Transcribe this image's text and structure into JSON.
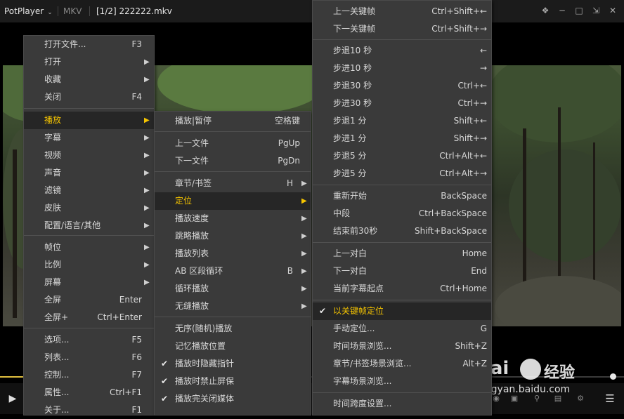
{
  "titlebar": {
    "app_name": "PotPlayer",
    "format": "MKV",
    "title": "[1/2] 222222.mkv"
  },
  "playback": {
    "seek_progress": 0.045
  },
  "main_menu": {
    "items": [
      {
        "label": "打开文件...",
        "key": "F3"
      },
      {
        "label": "打开",
        "submenu": true
      },
      {
        "label": "收藏",
        "submenu": true
      },
      {
        "label": "关闭",
        "key": "F4"
      },
      {
        "label": "播放",
        "submenu": true,
        "highlighted": true
      },
      {
        "label": "字幕",
        "submenu": true
      },
      {
        "label": "视频",
        "submenu": true
      },
      {
        "label": "声音",
        "submenu": true
      },
      {
        "label": "滤镜",
        "submenu": true
      },
      {
        "label": "皮肤",
        "submenu": true
      },
      {
        "label": "配置/语言/其他",
        "submenu": true
      },
      {
        "label": "帧位",
        "submenu": true
      },
      {
        "label": "比例",
        "submenu": true
      },
      {
        "label": "屏幕",
        "submenu": true
      },
      {
        "label": "全屏",
        "key": "Enter"
      },
      {
        "label": "全屏+",
        "key": "Ctrl+Enter"
      },
      {
        "label": "选项...",
        "key": "F5"
      },
      {
        "label": "列表...",
        "key": "F6"
      },
      {
        "label": "控制...",
        "key": "F7"
      },
      {
        "label": "属性...",
        "key": "Ctrl+F1"
      },
      {
        "label": "关于...",
        "key": "F1"
      }
    ]
  },
  "play_menu": {
    "items": [
      {
        "label": "播放|暂停",
        "key": "空格键"
      },
      {
        "label": "上一文件",
        "key": "PgUp"
      },
      {
        "label": "下一文件",
        "key": "PgDn"
      },
      {
        "label": "章节/书签",
        "key": "H",
        "submenu": true
      },
      {
        "label": "定位",
        "submenu": true,
        "highlighted": true
      },
      {
        "label": "播放速度",
        "submenu": true
      },
      {
        "label": "跳略播放",
        "submenu": true
      },
      {
        "label": "播放列表",
        "submenu": true
      },
      {
        "label": "AB 区段循环",
        "key": "B",
        "submenu": true
      },
      {
        "label": "循环播放",
        "submenu": true
      },
      {
        "label": "无缝播放",
        "submenu": true
      },
      {
        "label": "无序(随机)播放"
      },
      {
        "label": "记忆播放位置"
      },
      {
        "label": "播放时隐藏指针",
        "checked": true
      },
      {
        "label": "播放时禁止屏保",
        "checked": true
      },
      {
        "label": "播放完关闭媒体",
        "checked": true
      }
    ]
  },
  "seek_menu": {
    "items": [
      {
        "label": "上一关键帧",
        "key": "Ctrl+Shift+←"
      },
      {
        "label": "下一关键帧",
        "key": "Ctrl+Shift+→"
      },
      {
        "label": "步退10 秒",
        "key": "←"
      },
      {
        "label": "步进10 秒",
        "key": "→"
      },
      {
        "label": "步退30 秒",
        "key": "Ctrl+←"
      },
      {
        "label": "步进30 秒",
        "key": "Ctrl+→"
      },
      {
        "label": "步退1 分",
        "key": "Shift+←"
      },
      {
        "label": "步进1 分",
        "key": "Shift+→"
      },
      {
        "label": "步退5 分",
        "key": "Ctrl+Alt+←"
      },
      {
        "label": "步进5 分",
        "key": "Ctrl+Alt+→"
      },
      {
        "label": "重新开始",
        "key": "BackSpace"
      },
      {
        "label": "中段",
        "key": "Ctrl+BackSpace"
      },
      {
        "label": "结束前30秒",
        "key": "Shift+BackSpace"
      },
      {
        "label": "上一对白",
        "key": "Home"
      },
      {
        "label": "下一对白",
        "key": "End"
      },
      {
        "label": "当前字幕起点",
        "key": "Ctrl+Home"
      },
      {
        "label": "以关键帧定位",
        "checked": true,
        "highlighted": true
      },
      {
        "label": "手动定位...",
        "key": "G"
      },
      {
        "label": "时间场景浏览...",
        "key": "Shift+Z"
      },
      {
        "label": "章节/书签场景浏览...",
        "key": "Alt+Z"
      },
      {
        "label": "字幕场景浏览..."
      },
      {
        "label": "时间跨度设置..."
      }
    ]
  },
  "watermark": {
    "bai": "Bai",
    "du": "经验",
    "url": "jingyan.baidu.com"
  },
  "icons": {
    "play": "play-icon",
    "playlist": "playlist-menu-icon",
    "pin": "pin-icon",
    "minimize": "minimize-icon",
    "maximize": "maximize-icon",
    "fullscreen": "fullscreen-icon",
    "close": "close-icon"
  },
  "colors": {
    "highlight_text": "#f5c400",
    "menu_bg": "#3a3a3a"
  }
}
